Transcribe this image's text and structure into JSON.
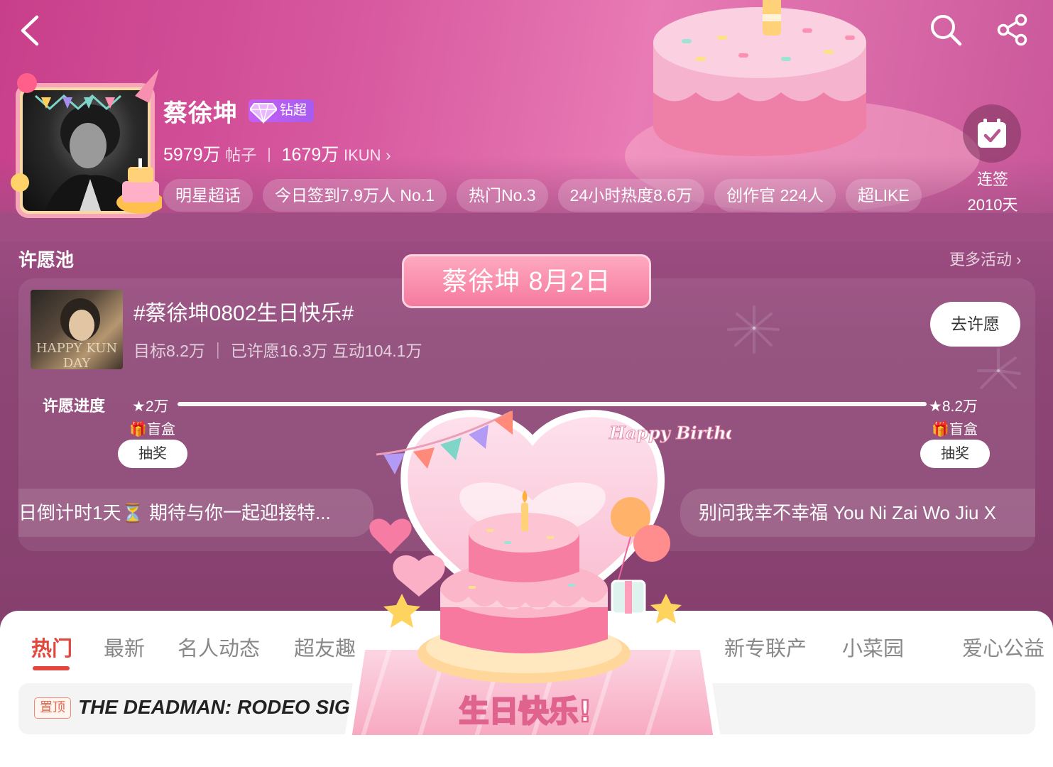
{
  "topbar": {
    "back_icon": "chevron-left-icon",
    "search_icon": "search-icon",
    "share_icon": "share-icon"
  },
  "profile": {
    "name": "蔡徐坤",
    "badge": "钻超",
    "posts_count": "5979万",
    "posts_label": "帖子",
    "fans_count": "1679万",
    "fans_label": "IKUN",
    "tags": [
      "明星超话",
      "今日签到7.9万人 No.1",
      "热门No.3",
      "24小时热度8.6万",
      "创作官 224人",
      "超LIKE"
    ]
  },
  "checkin": {
    "line1": "连签",
    "line2": "2010天"
  },
  "wish_pool": {
    "section_title": "许愿池",
    "more": "更多活动",
    "title": "#蔡徐坤0802生日快乐#",
    "meta": "目标8.2万 ｜ 已许愿16.3万 互动104.1万",
    "button": "去许愿",
    "thumb_text": "HAPPY KUN DAY",
    "progress": {
      "label": "许愿进度",
      "fraction": 1.0,
      "start_mark": "2万",
      "end_mark": "8.2万",
      "gift_left": "盲盒",
      "gift_right": "盲盒",
      "draw_left": "抽奖",
      "draw_right": "抽奖"
    },
    "ticker_left": "日倒计时1天⏳ 期待与你一起迎接特...",
    "ticker_right": "别问我幸不幸福 You Ni Zai Wo Jiu X"
  },
  "popup": {
    "date": "蔡徐坤 8月2日",
    "happy_birthday_en": "Happy Birthday",
    "greeting": "生日快乐!"
  },
  "tabs": [
    "热门",
    "最新",
    "名人动态",
    "超友趣",
    "新专联产",
    "小菜园",
    "爱心公益"
  ],
  "pinned": {
    "tag": "置顶",
    "text": "THE DEADMAN: RODEO SIGI"
  },
  "colors": {
    "accent_red": "#e2473d",
    "header_pink": "#d85aa0",
    "badge_purple": "#b35ef2"
  }
}
